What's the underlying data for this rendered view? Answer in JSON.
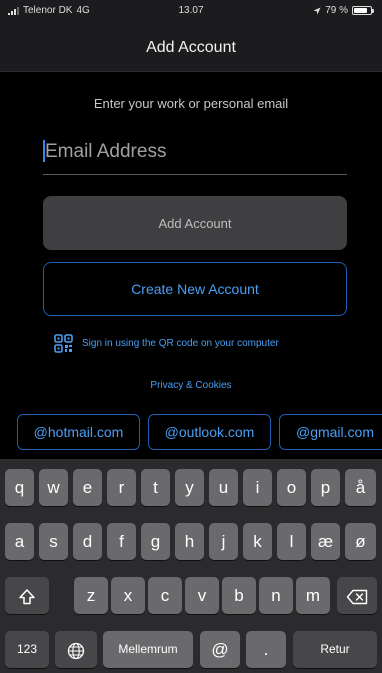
{
  "status_bar": {
    "carrier": "Telenor DK",
    "network": "4G",
    "time": "13.07",
    "battery": "79 %",
    "battery_level": 0.79
  },
  "nav": {
    "title": "Add Account"
  },
  "form": {
    "prompt": "Enter your work or personal email",
    "email_placeholder": "Email Address",
    "email_value": "",
    "add_account_label": "Add Account",
    "create_account_label": "Create New Account",
    "qr_text": "Sign in using the QR code on your computer",
    "privacy_label": "Privacy & Cookies"
  },
  "domain_chips": [
    "@hotmail.com",
    "@outlook.com",
    "@gmail.com"
  ],
  "keyboard": {
    "row1": [
      "q",
      "w",
      "e",
      "r",
      "t",
      "y",
      "u",
      "i",
      "o",
      "p",
      "å"
    ],
    "row2": [
      "a",
      "s",
      "d",
      "f",
      "g",
      "h",
      "j",
      "k",
      "l",
      "æ",
      "ø"
    ],
    "row3": [
      "z",
      "x",
      "c",
      "v",
      "b",
      "n",
      "m"
    ],
    "numbers_label": "123",
    "space_label": "Mellemrum",
    "at_label": "@",
    "dot_label": ".",
    "return_label": "Retur",
    "shift_icon": "shift-icon",
    "delete_icon": "delete-icon",
    "globe_icon": "globe-icon"
  },
  "colors": {
    "accent": "#4a9ff5",
    "outline": "#1e5fb3",
    "key": "#6a6a6d",
    "key_dark": "#47474a",
    "keyboard_bg": "#2b2b2d",
    "button_disabled": "#3f3f42"
  }
}
